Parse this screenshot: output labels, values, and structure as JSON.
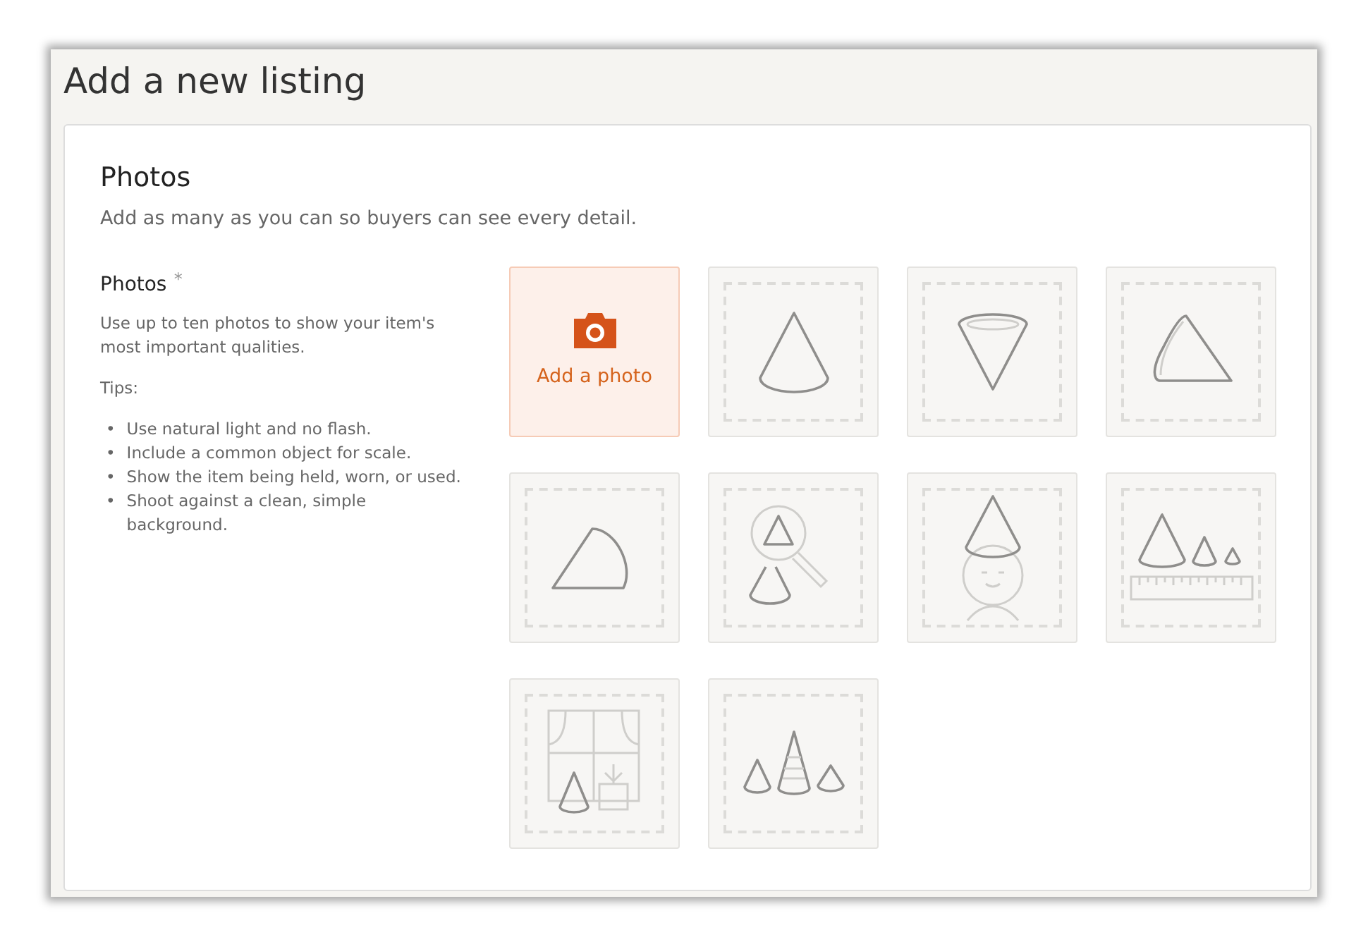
{
  "page": {
    "title": "Add a new listing"
  },
  "section": {
    "title": "Photos",
    "subtitle": "Add as many as you can so buyers can see every detail."
  },
  "field": {
    "label": "Photos",
    "required_mark": "*",
    "description": "Use up to ten photos to show your item's most important qualities.",
    "tips_label": "Tips:",
    "tips": [
      {
        "bullet": "•",
        "text": "Use natural light and no flash."
      },
      {
        "bullet": "•",
        "text": "Include a common object for scale."
      },
      {
        "bullet": "•",
        "text": "Show the item being held, worn, or used."
      },
      {
        "bullet": "•",
        "text": "Shoot against a clean, simple background."
      }
    ]
  },
  "add_photo": {
    "label": "Add a photo"
  },
  "slots": [
    {
      "kind": "cone"
    },
    {
      "kind": "cone-inverted"
    },
    {
      "kind": "cone-tilted"
    },
    {
      "kind": "cone-side"
    },
    {
      "kind": "magnifier"
    },
    {
      "kind": "head"
    },
    {
      "kind": "scale"
    },
    {
      "kind": "window"
    },
    {
      "kind": "group"
    }
  ]
}
